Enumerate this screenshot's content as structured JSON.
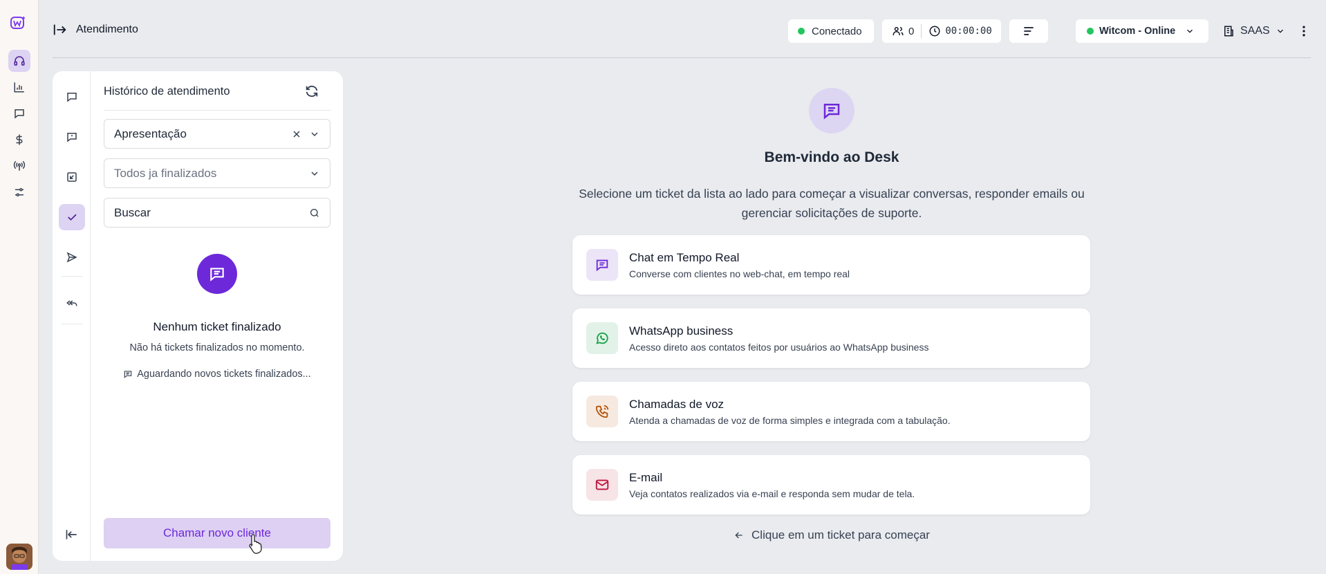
{
  "header": {
    "title": "Atendimento",
    "status_label": "Conectado",
    "queue_count": "0",
    "timer": "00:00:00",
    "channel_label": "Witcom - Online",
    "tenant_label": "SAAS"
  },
  "history": {
    "title": "Histórico de atendimento",
    "filter_value": "Apresentação",
    "status_placeholder": "Todos ja finalizados",
    "search_placeholder": "Buscar",
    "empty_title": "Nenhum ticket finalizado",
    "empty_subtitle": "Não há tickets finalizados no momento.",
    "empty_waiting": "Aguardando novos tickets finalizados...",
    "call_button": "Chamar novo cliente"
  },
  "welcome": {
    "title": "Bem-vindo ao Desk",
    "description": "Selecione um ticket da lista ao lado para começar a visualizar conversas, responder emails ou gerenciar solicitações de suporte.",
    "features": [
      {
        "title": "Chat em Tempo Real",
        "description": "Converse com clientes no web-chat, em tempo real",
        "icon": "chat-icon",
        "bg": "#ebe5f7",
        "color": "#6d28d9"
      },
      {
        "title": "WhatsApp business",
        "description": "Acesso direto aos contatos feitos por usuários ao WhatsApp business",
        "icon": "whatsapp-icon",
        "bg": "#e3f2e8",
        "color": "#16a34a"
      },
      {
        "title": "Chamadas de voz",
        "description": "Atenda a chamadas de voz de forma simples e integrada com a tabulação.",
        "icon": "phone-icon",
        "bg": "#f6e9e0",
        "color": "#b45309"
      },
      {
        "title": "E-mail",
        "description": "Veja contatos realizados via e-mail e responda sem mudar de tela.",
        "icon": "mail-icon",
        "bg": "#f6e4e6",
        "color": "#be123c"
      }
    ],
    "hint": "Clique em um ticket para começar"
  },
  "colors": {
    "accent": "#6d28d9",
    "online": "#22c55e"
  }
}
